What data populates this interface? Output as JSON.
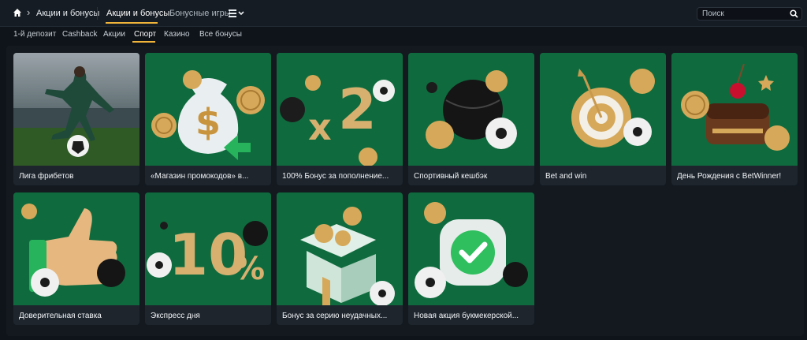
{
  "breadcrumb": {
    "current": "Акции и бонусы"
  },
  "tabs": [
    {
      "label": "Акции и бонусы",
      "active": true
    },
    {
      "label": "Бонусные игры",
      "active": false
    }
  ],
  "search": {
    "placeholder": "Поиск"
  },
  "subtabs": [
    {
      "label": "1-й депозит"
    },
    {
      "label": "Cashback"
    },
    {
      "label": "Акции"
    },
    {
      "label": "Спорт",
      "active": true
    },
    {
      "label": "Казино"
    },
    {
      "label": "Все бонусы"
    }
  ],
  "cards": [
    {
      "title": "Лига фрибетов"
    },
    {
      "title": "«Магазин промокодов» в..."
    },
    {
      "title": "100% Бонус за пополнение..."
    },
    {
      "title": "Спортивный кешбэк"
    },
    {
      "title": "Bet and win"
    },
    {
      "title": "День Рождения с BetWinner!"
    },
    {
      "title": "Доверительная ставка"
    },
    {
      "title": "Экспресс дня"
    },
    {
      "title": "Бонус за серию неудачных..."
    },
    {
      "title": "Новая акция букмекерской..."
    }
  ],
  "colors": {
    "accent": "#f0b43a",
    "card_green": "#0f6b3e",
    "gold": "#d6a95a"
  },
  "icons": [
    "home-icon",
    "chevron-right-icon",
    "menu-icon",
    "chevron-down-icon",
    "search-icon"
  ]
}
